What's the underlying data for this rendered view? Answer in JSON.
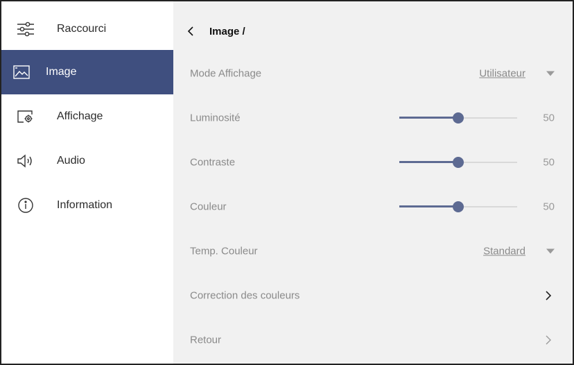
{
  "sidebar": {
    "items": [
      {
        "label": "Raccourci",
        "icon": "sliders-icon"
      },
      {
        "label": "Image",
        "icon": "image-icon",
        "active": true
      },
      {
        "label": "Affichage",
        "icon": "display-settings-icon"
      },
      {
        "label": "Audio",
        "icon": "speaker-icon"
      },
      {
        "label": "Information",
        "icon": "info-icon"
      }
    ]
  },
  "header": {
    "breadcrumb": "Image /"
  },
  "rows": {
    "mode": {
      "label": "Mode Affichage",
      "value": "Utilisateur"
    },
    "luminosite": {
      "label": "Luminosité",
      "value": "50",
      "level": 50
    },
    "contraste": {
      "label": "Contraste",
      "value": "50",
      "level": 50
    },
    "couleur": {
      "label": "Couleur",
      "value": "50",
      "level": 50
    },
    "temp": {
      "label": "Temp. Couleur",
      "value": "Standard"
    },
    "correction": {
      "label": "Correction des couleurs"
    },
    "retour": {
      "label": "Retour"
    }
  },
  "colors": {
    "accent": "#3f4f7f",
    "slider": "#5d6a92",
    "panel": "#f1f1f1"
  }
}
